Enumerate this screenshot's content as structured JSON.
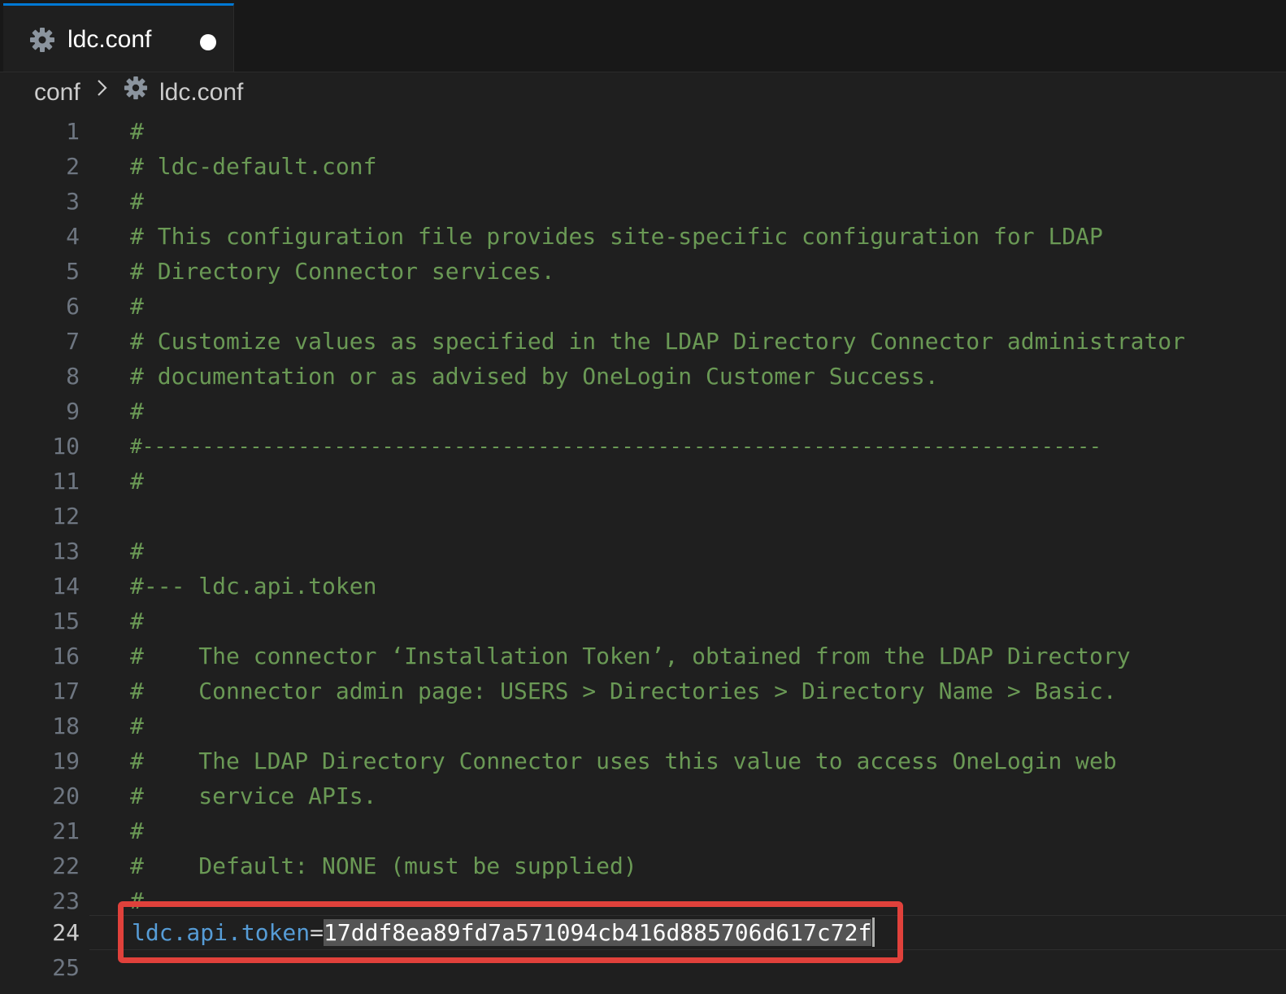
{
  "tab": {
    "label": "ldc.conf",
    "icon": "gear-icon",
    "modified": true
  },
  "breadcrumb": {
    "folder": "conf",
    "separator_icon": "chevron-right-icon",
    "file_icon": "gear-icon",
    "file": "ldc.conf"
  },
  "editor": {
    "lines": [
      {
        "number": "1",
        "text": "#"
      },
      {
        "number": "2",
        "text": "# ldc-default.conf"
      },
      {
        "number": "3",
        "text": "#"
      },
      {
        "number": "4",
        "text": "# This configuration file provides site-specific configuration for LDAP"
      },
      {
        "number": "5",
        "text": "# Directory Connector services."
      },
      {
        "number": "6",
        "text": "#"
      },
      {
        "number": "7",
        "text": "# Customize values as specified in the LDAP Directory Connector administrator"
      },
      {
        "number": "8",
        "text": "# documentation or as advised by OneLogin Customer Success."
      },
      {
        "number": "9",
        "text": "#"
      },
      {
        "number": "10",
        "text": "#--------------------------------------------------------------------------------"
      },
      {
        "number": "11",
        "text": "#"
      },
      {
        "number": "12",
        "text": ""
      },
      {
        "number": "13",
        "text": "#"
      },
      {
        "number": "14",
        "text": "#--- ldc.api.token"
      },
      {
        "number": "15",
        "text": "#"
      },
      {
        "number": "16",
        "text": "#    The connector ‘Installation Token’, obtained from the LDAP Directory"
      },
      {
        "number": "17",
        "text": "#    Connector admin page: USERS > Directories > Directory Name > Basic."
      },
      {
        "number": "18",
        "text": "#"
      },
      {
        "number": "19",
        "text": "#    The LDAP Directory Connector uses this value to access OneLogin web"
      },
      {
        "number": "20",
        "text": "#    service APIs."
      },
      {
        "number": "21",
        "text": "#"
      },
      {
        "number": "22",
        "text": "#    Default: NONE (must be supplied)"
      },
      {
        "number": "23",
        "text": "#"
      }
    ],
    "token_line": {
      "number": "24",
      "key": "ldc.api.token",
      "equals": "=",
      "value": "17ddf8ea89fd7a571094cb416d885706d617c72f"
    },
    "last_line": {
      "number": "25",
      "text": ""
    }
  },
  "colors": {
    "comment": "#6a9955",
    "key": "#569cd6",
    "highlight_box": "#e0413b",
    "tab_accent": "#0078d4"
  }
}
